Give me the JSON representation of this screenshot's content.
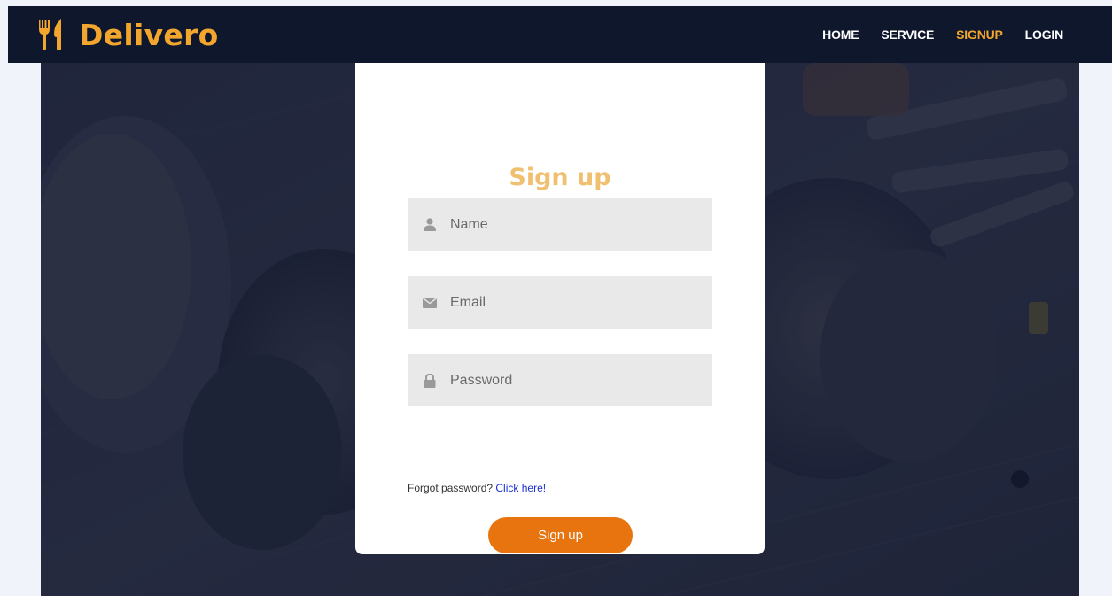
{
  "colors": {
    "accent": "#f2a62d",
    "title": "#f0c070",
    "button": "#e8740f",
    "navbar": "#0f172c",
    "link": "#1a2fd0"
  },
  "header": {
    "brand": {
      "name": "Delivero",
      "icon": "fork-knife-icon"
    },
    "nav": [
      {
        "label": "HOME",
        "active": false
      },
      {
        "label": "SERVICE",
        "active": false
      },
      {
        "label": "SIGNUP",
        "active": true
      },
      {
        "label": "LOGIN",
        "active": false
      }
    ]
  },
  "form": {
    "title": "Sign up",
    "fields": [
      {
        "icon": "user-icon",
        "placeholder": "Name",
        "value": ""
      },
      {
        "icon": "envelope-icon",
        "placeholder": "Email",
        "value": ""
      },
      {
        "icon": "lock-icon",
        "placeholder": "Password",
        "value": ""
      }
    ],
    "forgot_text": "Forgot password?",
    "forgot_link": "Click here!",
    "submit_label": "Sign up"
  }
}
